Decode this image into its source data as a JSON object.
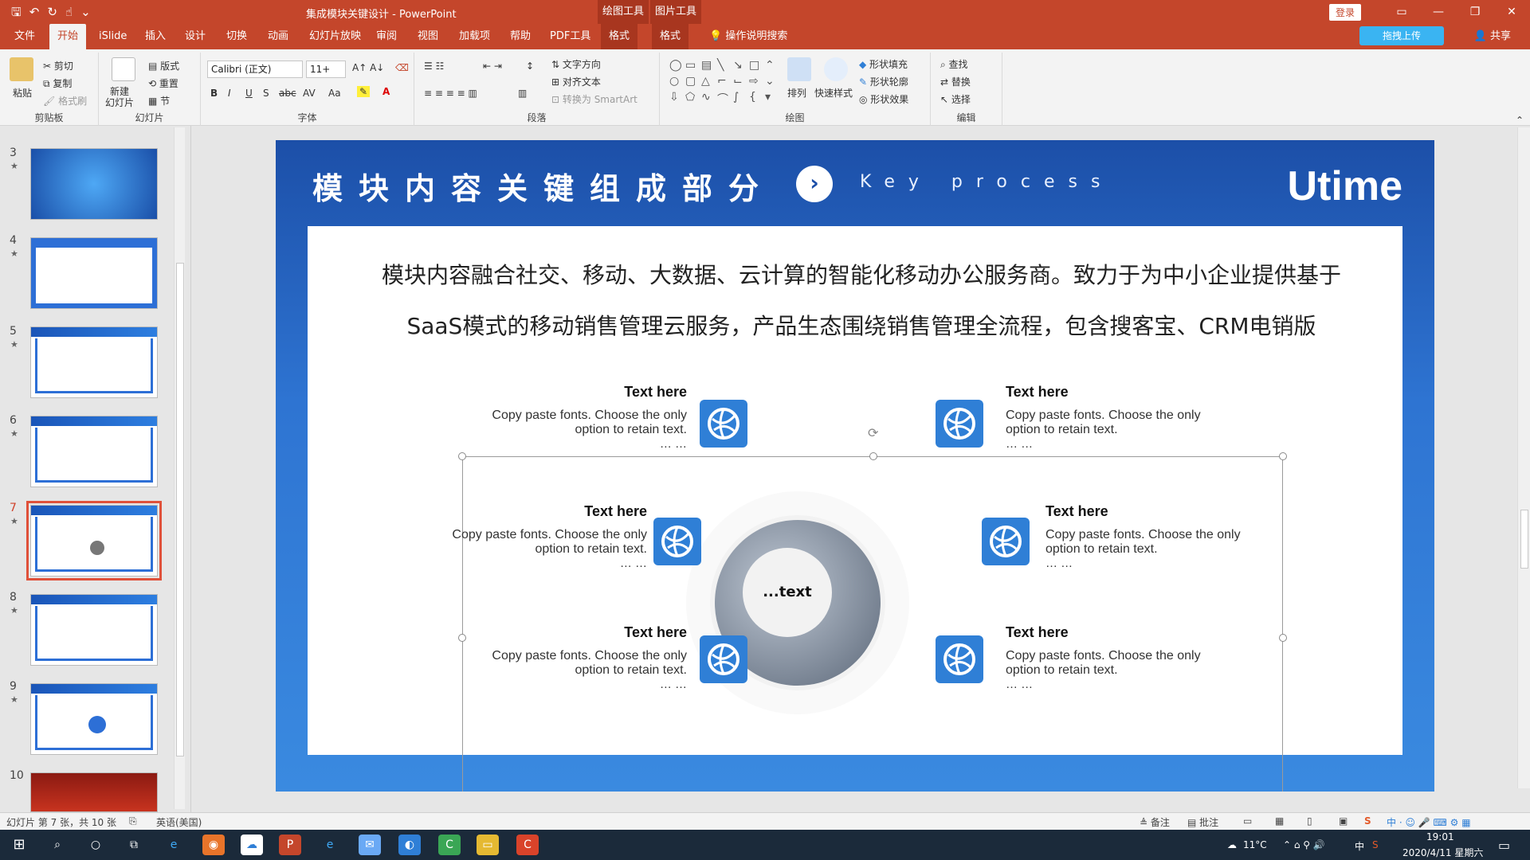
{
  "window": {
    "doc_title": "集成模块关键设计 - PowerPoint",
    "context_tabs": [
      "绘图工具",
      "图片工具"
    ],
    "login_label": "登录",
    "controls": [
      "▭",
      "—",
      "❐",
      "✕"
    ]
  },
  "menu": {
    "tabs": [
      "文件",
      "开始",
      "iSlide",
      "插入",
      "设计",
      "切换",
      "动画",
      "幻灯片放映",
      "审阅",
      "视图",
      "加载项",
      "帮助",
      "PDF工具",
      "格式",
      "格式"
    ],
    "active_index": 1,
    "tell_me": "操作说明搜索",
    "upload_label": "拖拽上传",
    "share_label": "共享"
  },
  "ribbon": {
    "clipboard": {
      "paste": "粘贴",
      "cut": "剪切",
      "copy": "复制",
      "format_painter": "格式刷",
      "label": "剪贴板"
    },
    "slides": {
      "new_slide": "新建\n幻灯片",
      "layout": "版式",
      "reset": "重置",
      "section": "节",
      "label": "幻灯片"
    },
    "font": {
      "name": "Calibri (正文)",
      "size": "11+",
      "bold": "B",
      "italic": "I",
      "underline": "U",
      "shadow": "S",
      "strike": "abc",
      "spacing": "AV",
      "case": "Aa",
      "label": "字体"
    },
    "paragraph": {
      "text_direction": "文字方向",
      "align_text": "对齐文本",
      "smartart": "转换为 SmartArt",
      "label": "段落"
    },
    "drawing": {
      "arrange": "排列",
      "quick_styles": "快速样式",
      "shape_fill": "形状填充",
      "shape_outline": "形状轮廓",
      "shape_effects": "形状效果",
      "label": "绘图"
    },
    "editing": {
      "find": "查找",
      "replace": "替换",
      "select": "选择",
      "label": "编辑"
    }
  },
  "thumbnails": [
    {
      "num": "3",
      "star": "★"
    },
    {
      "num": "4",
      "star": "★"
    },
    {
      "num": "5",
      "star": "★"
    },
    {
      "num": "6",
      "star": "★"
    },
    {
      "num": "7",
      "star": "★"
    },
    {
      "num": "8",
      "star": "★"
    },
    {
      "num": "9",
      "star": "★"
    },
    {
      "num": "10",
      "star": ""
    }
  ],
  "selected_thumbnail": "7",
  "slide": {
    "title": "模块内容关键组成部分",
    "subtitle_en": "Key process",
    "logo": "Utime",
    "paragraph_line1": "模块内容融合社交、移动、大数据、云计算的智能化移动办公服务商。致力于为中小企业提供基于",
    "paragraph_line2": "SaaS模式的移动销售管理云服务，产品生态围绕销售管理全流程，包含搜客宝、CRM电销版",
    "center_label": "...text",
    "blocks": [
      {
        "heading": "Text here",
        "body": "Copy paste fonts. Choose the only option to retain text.",
        "dots": "… …"
      },
      {
        "heading": "Text here",
        "body": "Copy paste fonts. Choose the only option to retain text.",
        "dots": "… …"
      },
      {
        "heading": "Text here",
        "body": "Copy paste fonts. Choose the only option to retain text.",
        "dots": "… …"
      },
      {
        "heading": "Text here",
        "body": "Copy paste fonts. Choose the only option to retain text.",
        "dots": "… …"
      },
      {
        "heading": "Text here",
        "body": "Copy paste fonts. Choose the only option to retain text.",
        "dots": "… …"
      },
      {
        "heading": "Text here",
        "body": "Copy paste fonts. Choose the only option to retain text.",
        "dots": "… …"
      }
    ]
  },
  "status": {
    "slide_info": "幻灯片 第 7 张，共 10 张",
    "language": "英语(美国)",
    "notes": "备注",
    "comments": "批注"
  },
  "taskbar": {
    "temperature": "11°C",
    "ime": "中",
    "time": "19:01",
    "date": "2020/4/11 星期六"
  },
  "colors": {
    "accent": "#c4462b",
    "slide_blue": "#2f7fd6"
  }
}
